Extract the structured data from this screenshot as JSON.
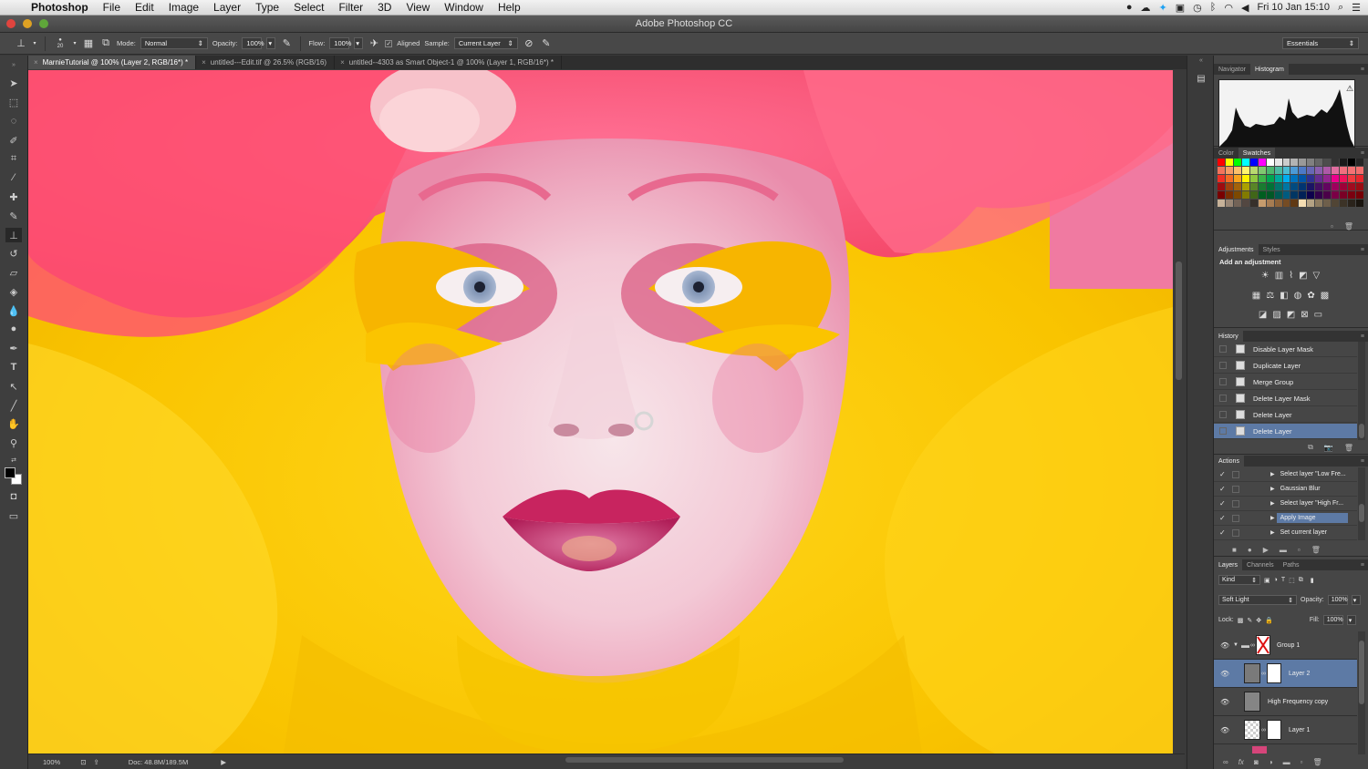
{
  "menubar": {
    "app": "Photoshop",
    "items": [
      "File",
      "Edit",
      "Image",
      "Layer",
      "Type",
      "Select",
      "Filter",
      "3D",
      "View",
      "Window",
      "Help"
    ],
    "clock": "Fri 10 Jan  15:10"
  },
  "window": {
    "title": "Adobe Photoshop CC"
  },
  "options": {
    "mode_label": "Mode:",
    "mode_value": "Normal",
    "opacity_label": "Opacity:",
    "opacity_value": "100%",
    "flow_label": "Flow:",
    "flow_value": "100%",
    "aligned_label": "Aligned",
    "sample_label": "Sample:",
    "sample_value": "Current Layer",
    "brush_size": "20",
    "workspace": "Essentials"
  },
  "tabs": [
    {
      "label": "MarnieTutorial @ 100% (Layer 2, RGB/16*) *",
      "active": true
    },
    {
      "label": "untitled---Edit.tif @ 26.5% (RGB/16)",
      "active": false
    },
    {
      "label": "untitled--4303 as Smart Object-1 @ 100% (Layer 1, RGB/16*) *",
      "active": false
    }
  ],
  "status": {
    "zoom": "100%",
    "doc": "Doc: 48.8M/189.5M"
  },
  "panels": {
    "nav_tabs": [
      "Navigator",
      "Histogram"
    ],
    "color_tabs": [
      "Color",
      "Swatches"
    ],
    "adj_tabs": [
      "Adjustments",
      "Styles"
    ],
    "adj_title": "Add an adjustment",
    "history_tab": "History",
    "history": [
      "Disable Layer Mask",
      "Duplicate Layer",
      "Merge Group",
      "Delete Layer Mask",
      "Delete Layer",
      "Delete Layer"
    ],
    "actions_tab": "Actions",
    "actions": [
      "Select layer \"Low Fre...",
      "Gaussian Blur",
      "Select layer \"High Fr...",
      "Apply Image",
      "Set current layer"
    ],
    "layer_tabs": [
      "Layers",
      "Channels",
      "Paths"
    ],
    "kind_label": "Kind",
    "blend_mode": "Soft Light",
    "opacity_label": "Opacity:",
    "opacity_value": "100%",
    "lock_label": "Lock:",
    "fill_label": "Fill:",
    "fill_value": "100%",
    "layers": [
      "Group 1",
      "Layer 2",
      "High Frequency copy",
      "Layer 1"
    ]
  },
  "colors": {
    "accent": "#5d7aa5",
    "canvas_bg": "#f6c80a"
  }
}
